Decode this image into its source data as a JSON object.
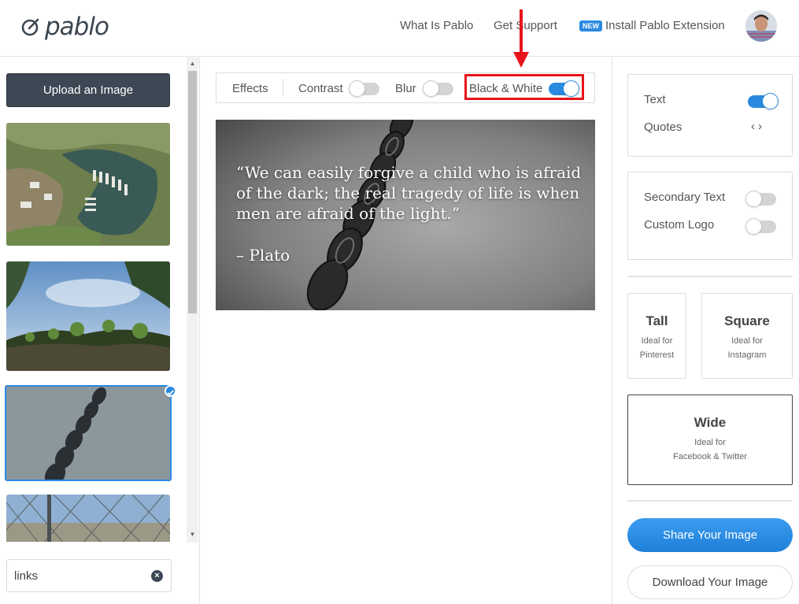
{
  "header": {
    "logo_text": "pablo",
    "nav": {
      "what_is": "What Is Pablo",
      "support": "Get Support",
      "new_badge": "NEW",
      "install": "Install Pablo Extension"
    }
  },
  "left": {
    "upload_label": "Upload an Image",
    "search": {
      "value": "links"
    }
  },
  "toolbar": {
    "effects_label": "Effects",
    "contrast_label": "Contrast",
    "contrast_on": false,
    "blur_label": "Blur",
    "blur_on": false,
    "bw_label": "Black & White",
    "bw_on": true
  },
  "canvas": {
    "quote": "“We can easily forgive a child who is afraid of the dark; the real tragedy of life is when men are afraid of the light.”",
    "author": "– Plato"
  },
  "right": {
    "text_label": "Text",
    "text_on": true,
    "quotes_label": "Quotes",
    "quotes_arrows": "‹›",
    "secondary_label": "Secondary Text",
    "secondary_on": false,
    "logo_label": "Custom Logo",
    "logo_on": false,
    "sizes": [
      {
        "title": "Tall",
        "line1": "Ideal for",
        "line2": "Pinterest"
      },
      {
        "title": "Square",
        "line1": "Ideal for",
        "line2": "Instagram"
      },
      {
        "title": "Wide",
        "line1": "Ideal for",
        "line2": "Facebook & Twitter"
      }
    ],
    "share_label": "Share Your Image",
    "download_label": "Download Your Image"
  },
  "colors": {
    "accent": "#2a8ae0",
    "annotation_red": "#e8141b",
    "dark_button": "#3e4854"
  }
}
